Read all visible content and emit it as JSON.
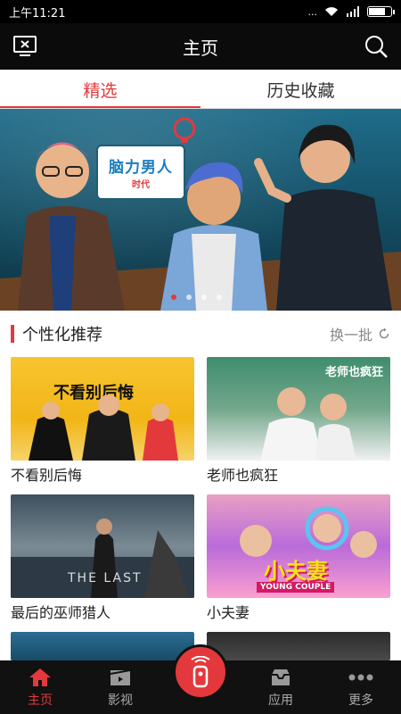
{
  "status_bar": {
    "time": "上午11:21",
    "signal_text": "..."
  },
  "header": {
    "title": "主页"
  },
  "tabs": [
    {
      "label": "精选",
      "active": true
    },
    {
      "label": "历史收藏",
      "active": false
    }
  ],
  "banner": {
    "logo_title": "脑力男人",
    "logo_subtitle": "时代",
    "slide_count": 4,
    "active_slide": 1
  },
  "section": {
    "title": "个性化推荐",
    "refresh_label": "换一批"
  },
  "cards": [
    {
      "caption": "不看别后悔",
      "thumb_title": "不看别后悔"
    },
    {
      "caption": "老师也疯狂",
      "thumb_title": "老师也疯狂"
    },
    {
      "caption": "最后的巫师猎人",
      "thumb_title": "THE LAST"
    },
    {
      "caption": "小夫妻",
      "thumb_title": "小夫妻",
      "thumb_subtitle": "YOUNG COUPLE"
    }
  ],
  "nav": [
    {
      "label": "主页",
      "active": true,
      "icon": "home-icon"
    },
    {
      "label": "影视",
      "active": false,
      "icon": "film-icon"
    },
    {
      "label": "",
      "active": false,
      "icon": "cast-icon"
    },
    {
      "label": "应用",
      "active": false,
      "icon": "apps-icon"
    },
    {
      "label": "更多",
      "active": false,
      "icon": "more-icon"
    }
  ],
  "colors": {
    "accent": "#e4393c",
    "nav_bg": "#111111",
    "header_bg": "#0b0b0b"
  }
}
